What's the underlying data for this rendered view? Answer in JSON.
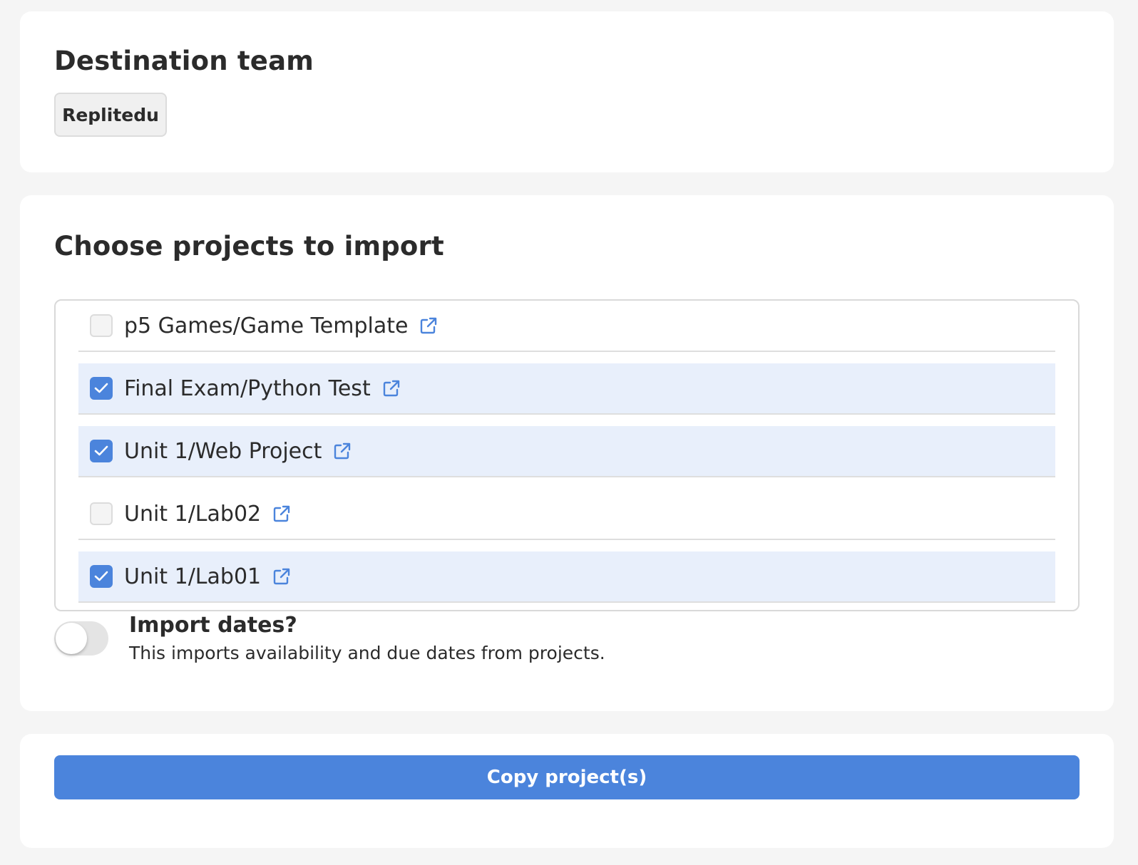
{
  "destination": {
    "title": "Destination team",
    "team_name": "Replitedu"
  },
  "projects": {
    "title": "Choose projects to import",
    "items": [
      {
        "label": "p5 Games/Game Template",
        "checked": false
      },
      {
        "label": "Final Exam/Python Test",
        "checked": true
      },
      {
        "label": "Unit 1/Web Project",
        "checked": true
      },
      {
        "label": "Unit 1/Lab02",
        "checked": false
      },
      {
        "label": "Unit 1/Lab01",
        "checked": true
      }
    ],
    "import_dates": {
      "title": "Import dates?",
      "description": "This imports availability and due dates from projects.",
      "enabled": false
    }
  },
  "actions": {
    "copy_label": "Copy project(s)"
  },
  "icons": {
    "row_icon": "external-link-icon",
    "check_icon": "checkmark-icon"
  },
  "colors": {
    "accent": "#4b84dc",
    "selected_row": "#e8effb",
    "page_background": "#f5f5f5",
    "card_background": "#ffffff"
  }
}
